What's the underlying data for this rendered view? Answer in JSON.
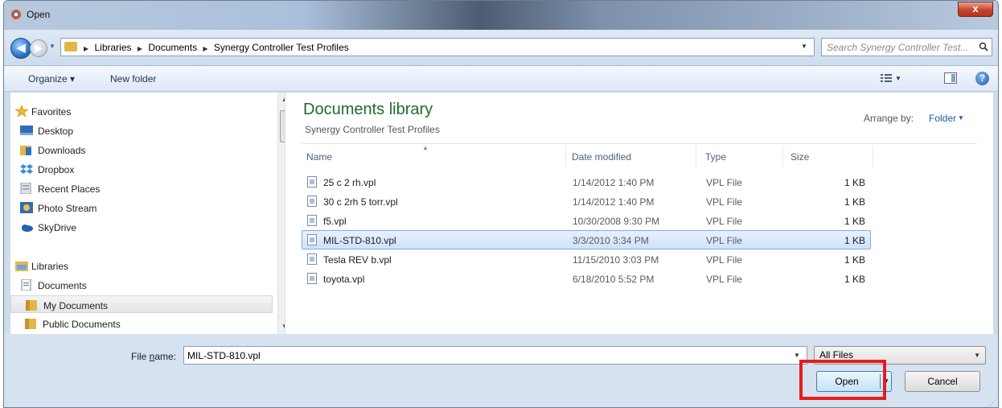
{
  "window": {
    "title": "Open",
    "close_glyph": "x"
  },
  "nav": {
    "back_glyph": "◀",
    "fwd_glyph": "▶",
    "breadcrumbs": [
      "Libraries",
      "Documents",
      "Synergy Controller Test Profiles"
    ],
    "search_placeholder": "Search Synergy Controller Test...",
    "refresh_glyph": "↻"
  },
  "toolbar": {
    "organize_label": "Organize ▾",
    "new_folder_label": "New folder",
    "help_glyph": "?"
  },
  "sidebar": {
    "favorites_header": "Favorites",
    "favorites": [
      {
        "label": "Desktop",
        "icon": "desktop-icon"
      },
      {
        "label": "Downloads",
        "icon": "downloads-icon"
      },
      {
        "label": "Dropbox",
        "icon": "dropbox-icon"
      },
      {
        "label": "Recent Places",
        "icon": "recent-places-icon"
      },
      {
        "label": "Photo Stream",
        "icon": "photo-stream-icon"
      },
      {
        "label": "SkyDrive",
        "icon": "skydrive-icon"
      }
    ],
    "libraries_header": "Libraries",
    "libraries": [
      {
        "label": "Documents",
        "icon": "documents-icon"
      },
      {
        "label": "My Documents",
        "icon": "folder-icon",
        "selected": true
      },
      {
        "label": "Public Documents",
        "icon": "folder-icon"
      }
    ]
  },
  "library": {
    "title": "Documents library",
    "subtitle": "Synergy Controller Test Profiles",
    "arrange_label": "Arrange by:",
    "arrange_value": "Folder"
  },
  "columns": [
    "Name",
    "Date modified",
    "Type",
    "Size"
  ],
  "files": [
    {
      "name": "25 c  2 rh.vpl",
      "date": "1/14/2012 1:40 PM",
      "type": "VPL File",
      "size": "1 KB"
    },
    {
      "name": "30 c  2rh  5 torr.vpl",
      "date": "1/14/2012 1:40 PM",
      "type": "VPL File",
      "size": "1 KB"
    },
    {
      "name": "f5.vpl",
      "date": "10/30/2008 9:30 PM",
      "type": "VPL File",
      "size": "1 KB"
    },
    {
      "name": "MIL-STD-810.vpl",
      "date": "3/3/2010 3:34 PM",
      "type": "VPL File",
      "size": "1 KB",
      "selected": true
    },
    {
      "name": "Tesla REV b.vpl",
      "date": "11/15/2010 3:03 PM",
      "type": "VPL File",
      "size": "1 KB"
    },
    {
      "name": "toyota.vpl",
      "date": "6/18/2010 5:52 PM",
      "type": "VPL File",
      "size": "1 KB"
    }
  ],
  "bottom": {
    "file_name_label_pre": "File ",
    "file_name_label_u": "n",
    "file_name_label_post": "ame:",
    "file_name_value": "MIL-STD-810.vpl",
    "filter_value": "All Files",
    "open_label": "Open",
    "cancel_label": "Cancel"
  },
  "colors": {
    "library_title": "#1e6b2b",
    "highlight": "#e81c1c",
    "selection": "#cfe3fb"
  }
}
